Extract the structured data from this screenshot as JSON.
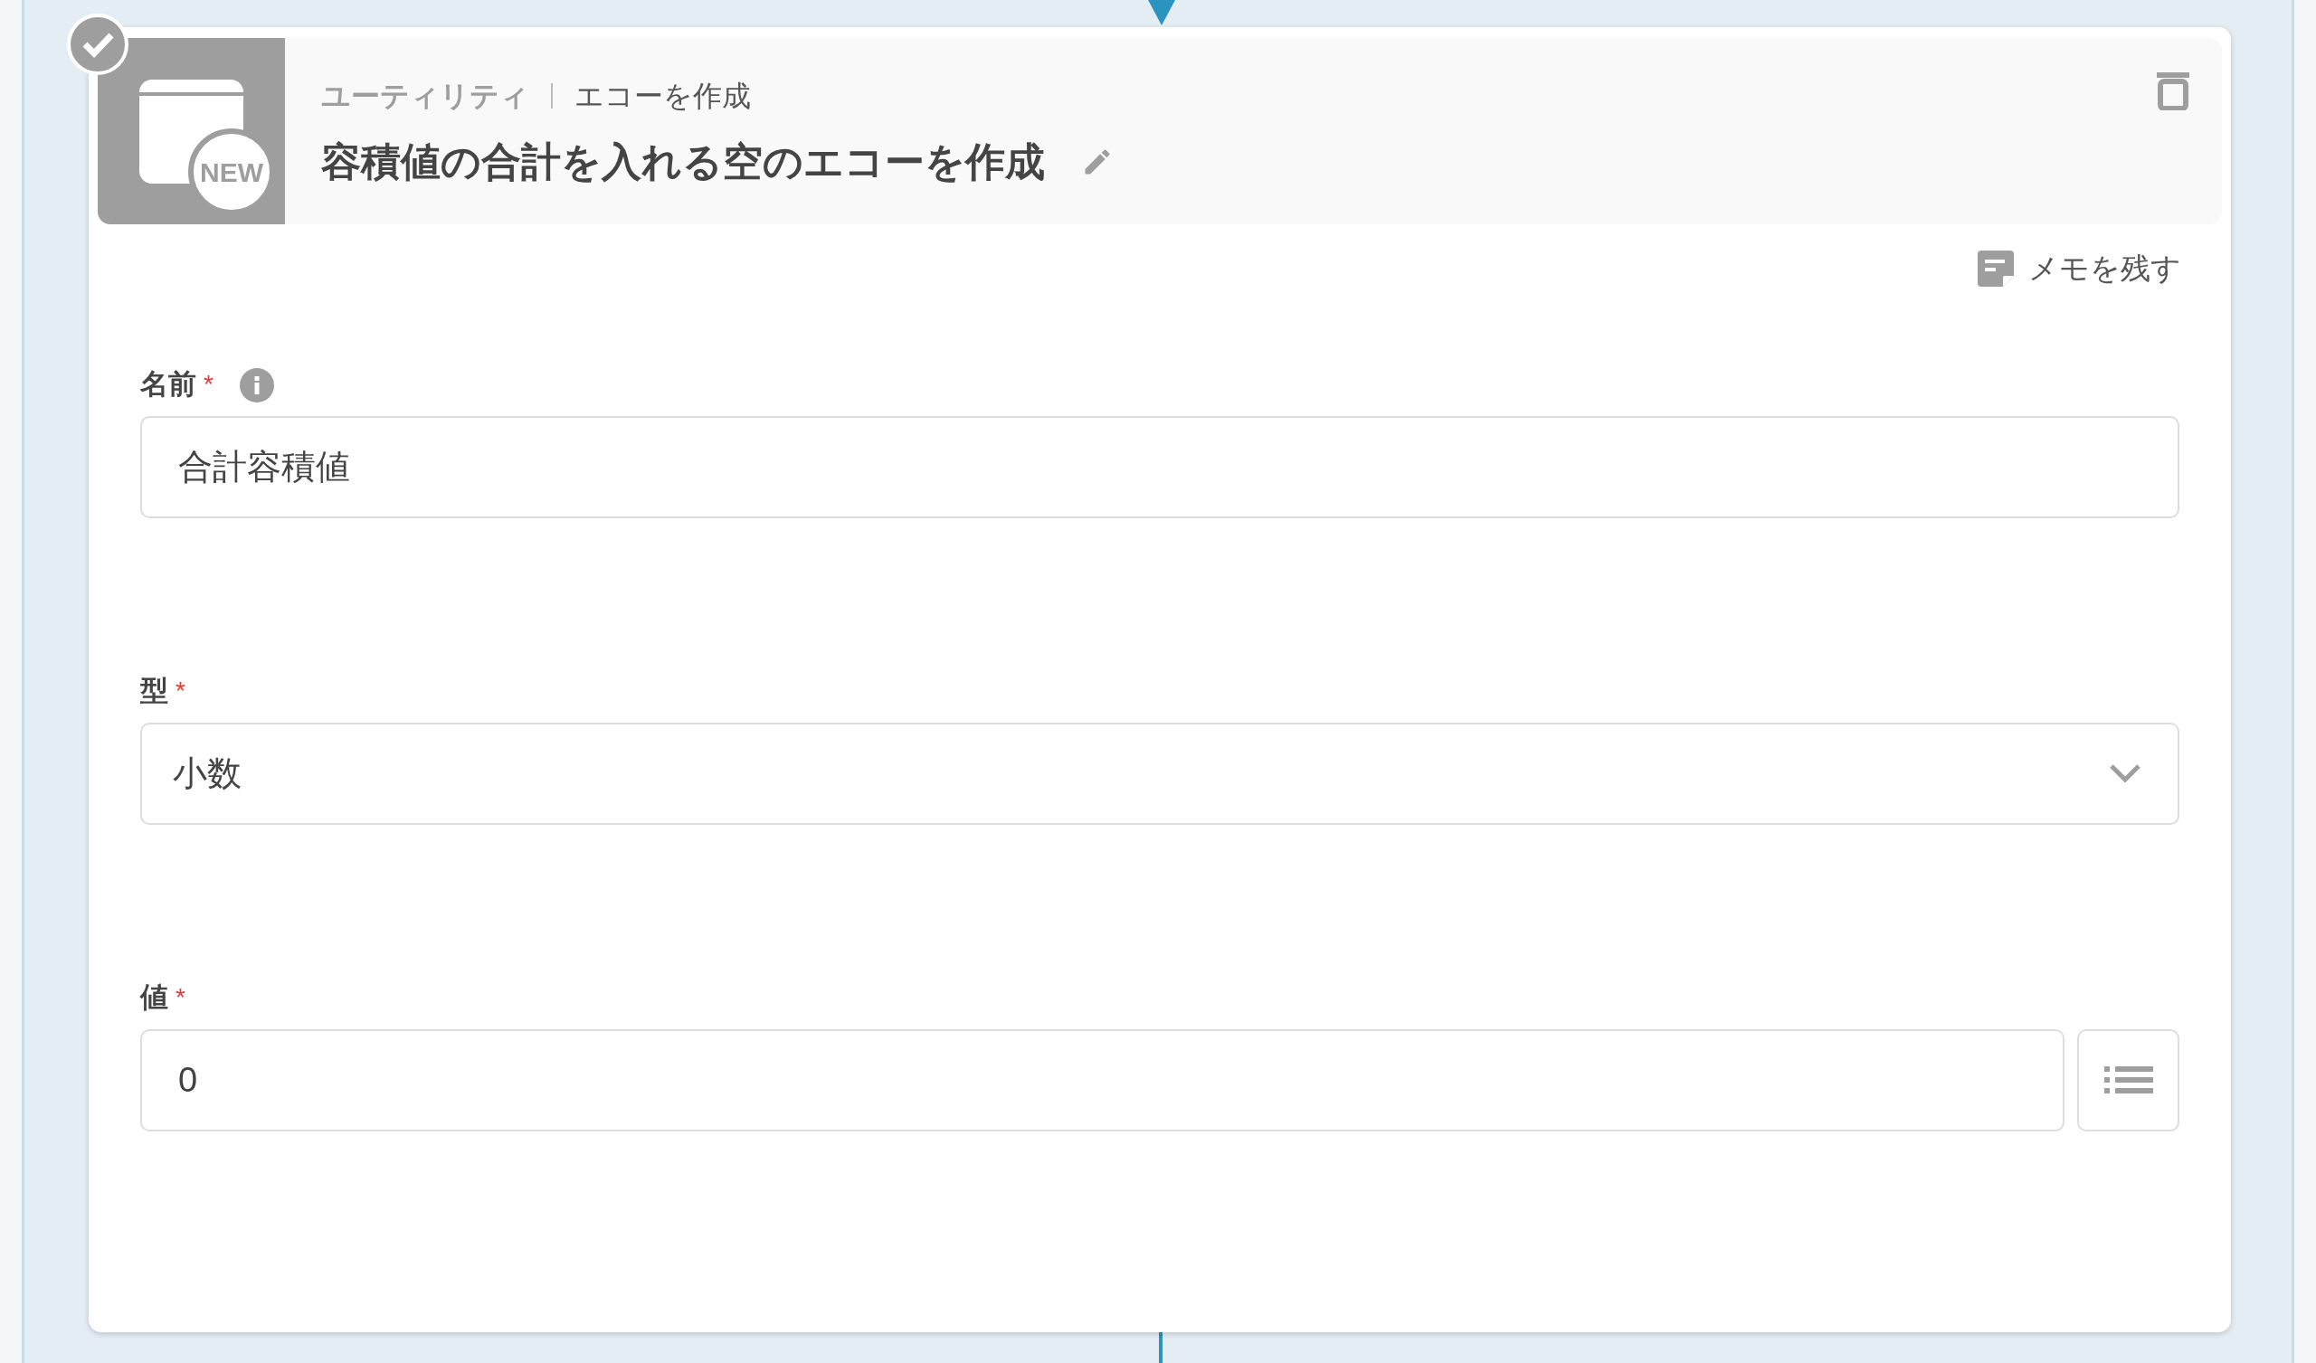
{
  "step": {
    "completed": true,
    "category": "ユーティリティ",
    "action": "エコーを作成",
    "title": "容積値の合計を入れる空のエコーを作成",
    "icon_badge": "NEW"
  },
  "memo_button": "メモを残す",
  "fields": [
    {
      "kind": "text",
      "label": "名前",
      "required_mark": "*",
      "info": true,
      "value": "合計容積値"
    },
    {
      "kind": "select",
      "label": "型",
      "required_mark": "*",
      "info": false,
      "value": "小数"
    },
    {
      "kind": "text_with_list",
      "label": "値",
      "required_mark": "*",
      "info": false,
      "value": "0"
    }
  ]
}
